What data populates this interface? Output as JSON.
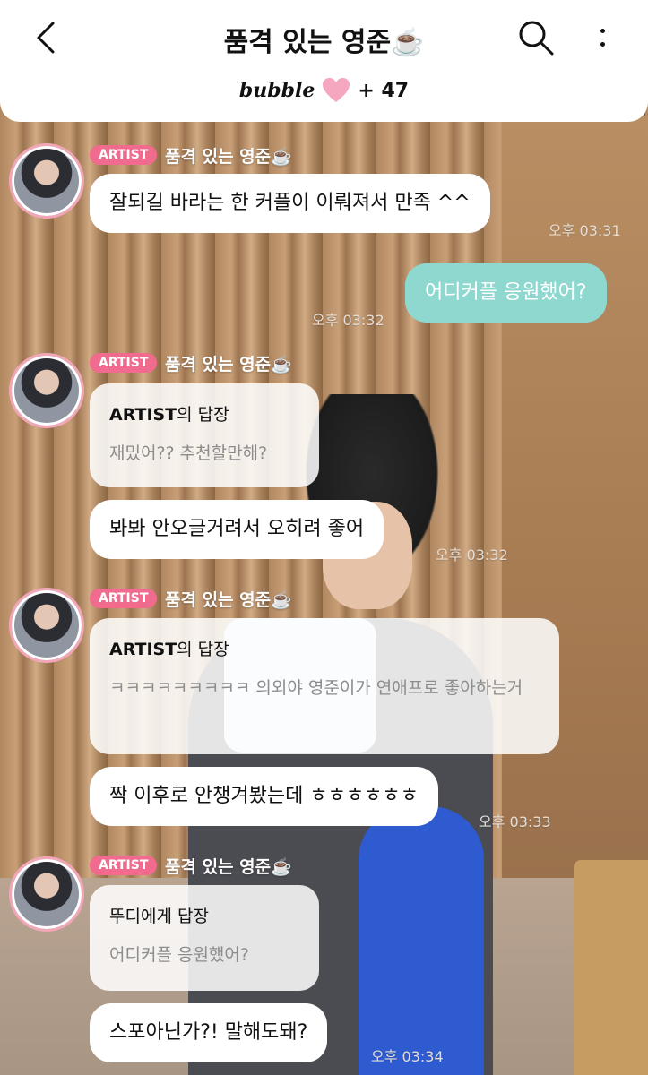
{
  "header": {
    "title": "품격 있는 영준☕️",
    "brand": "bubble",
    "plus_count": "+ 47"
  },
  "messages": {
    "g1": {
      "badge": "ARTIST",
      "sender": "품격 있는 영준☕️",
      "text": "잘되길 바라는 한 커플이 이뤄져서 만족 ^^",
      "time": "오후 03:31"
    },
    "mine1": {
      "text": "어디커플 응원했어?",
      "time": "오후 03:32"
    },
    "g2": {
      "badge": "ARTIST",
      "sender": "품격 있는 영준☕️",
      "reply_name": "ARTIST",
      "reply_suffix": "의 답장",
      "reply_body": "재밌어?? 추천할만해?",
      "text": "봐봐 안오글거려서 오히려 좋어",
      "time": "오후 03:32"
    },
    "g3": {
      "badge": "ARTIST",
      "sender": "품격 있는 영준☕️",
      "reply_name": "ARTIST",
      "reply_suffix": "의 답장",
      "reply_body": "ㅋㅋㅋㅋㅋㅋㅋㅋㅋ 의외야 영준이가 연애프로 좋아하는거",
      "text": "짝 이후로 안챙겨봤는데 ㅎㅎㅎㅎㅎㅎ",
      "time": "오후 03:33"
    },
    "g4": {
      "badge": "ARTIST",
      "sender": "품격 있는 영준☕️",
      "reply_head": "뚜디에게 답장",
      "reply_body": "어디커플 응원했어?",
      "text": "스포아닌가?! 말해도돼?",
      "time": "오후 03:34"
    }
  },
  "colors": {
    "badge": "#f06b8e",
    "mine_bubble": "#8fd8cf",
    "avatar_ring": "#f2a7b8"
  }
}
